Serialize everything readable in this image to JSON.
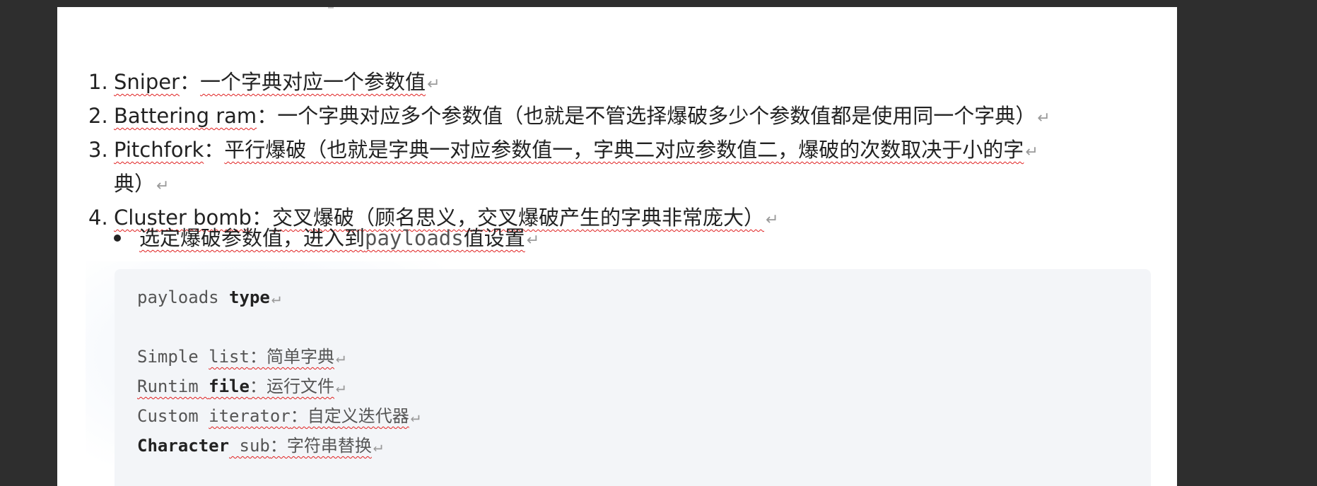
{
  "list": {
    "item1": {
      "num": "1.",
      "label": "Sniper",
      "sep": "：",
      "text": "一个字典对应一个参数值"
    },
    "item2": {
      "num": "2.",
      "label": "Battering ram",
      "sep": "：",
      "text": "一个字典对应多个参数值（也就是不管选择爆破多少个参数值都是使用同一个字典）"
    },
    "item3": {
      "num": "3.",
      "label": "Pitchfork",
      "sep": "：",
      "text": "平行爆破（也就是字典一对应参数值一，字典二对应参数值二，爆破的次数取决于小的字",
      "text_cont": "典）"
    },
    "item4": {
      "num": "4.",
      "label": "Cluster bomb",
      "sep": "：",
      "text": "交叉爆破（顾名思义，交叉爆破产生的字典非常庞大）"
    }
  },
  "bullet": {
    "pre": "选定爆破参数值，进入到",
    "code": "payloads",
    "post": "值设置"
  },
  "code": {
    "line1": {
      "a": "payloads ",
      "b": "type"
    },
    "line2": {
      "a": "Simple ",
      "b": "list",
      "c": "：简单字典"
    },
    "line3": {
      "a": "Runtim ",
      "b": "file",
      "c": "：运行文件"
    },
    "line4": {
      "a": "Custom ",
      "b": "iterator",
      "c": "：自定义迭代器"
    },
    "line5": {
      "a": "Character",
      "b": " sub",
      "c": "：字符串替换"
    }
  },
  "paragraph_mark": "↵"
}
